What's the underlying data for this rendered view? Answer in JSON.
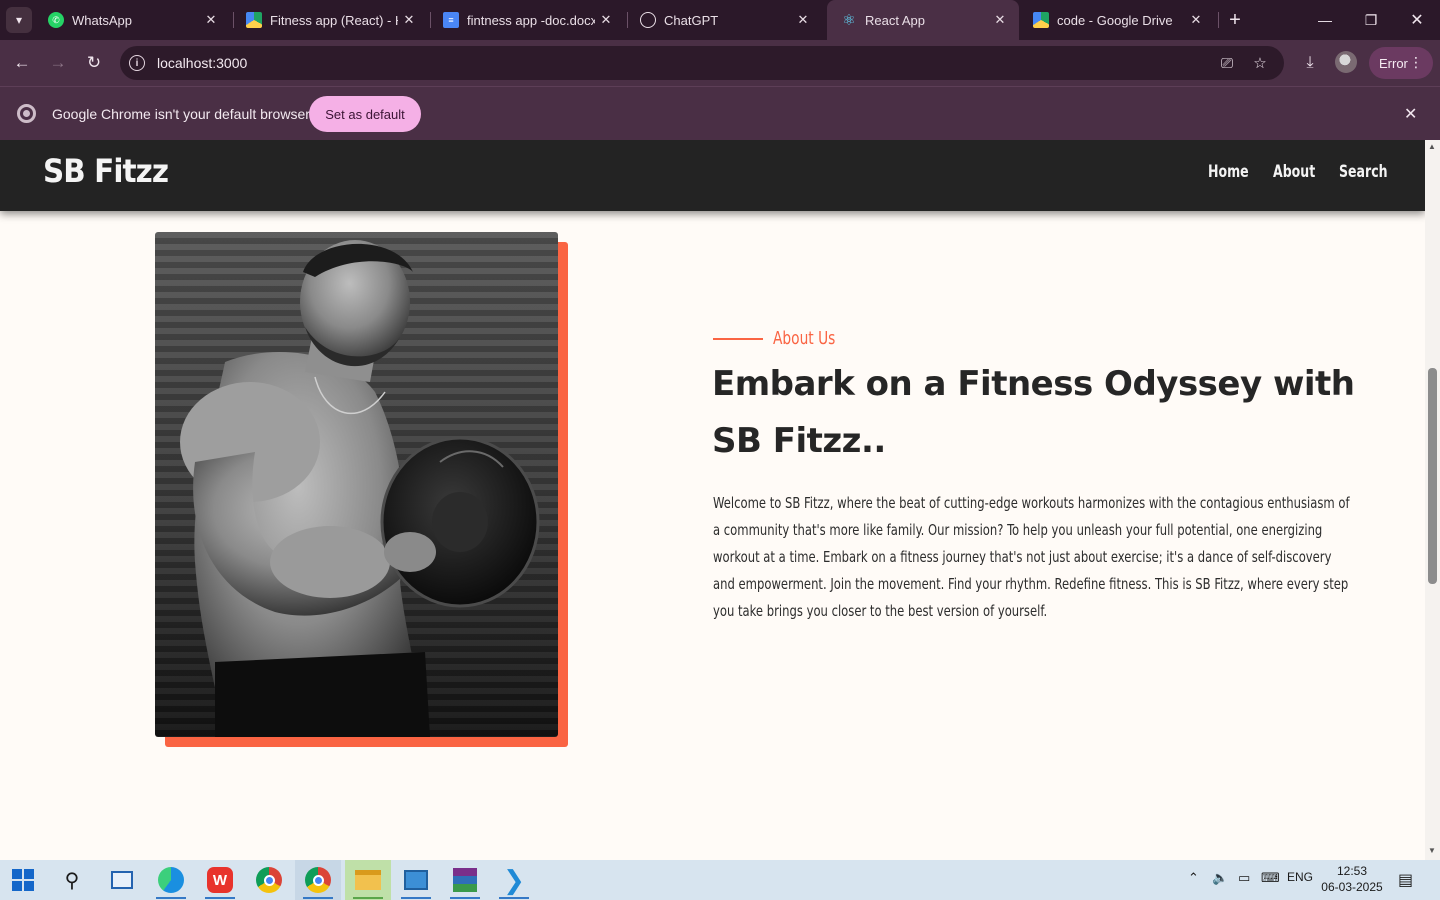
{
  "browser": {
    "tabs": [
      {
        "title": "WhatsApp",
        "icon": "whatsapp-icon",
        "active": false
      },
      {
        "title": "Fitness app (React) - Ha",
        "icon": "google-drive-icon",
        "active": false
      },
      {
        "title": "fintness app -doc.docx",
        "icon": "google-docs-icon",
        "active": false
      },
      {
        "title": "ChatGPT",
        "icon": "chatgpt-icon",
        "active": false
      },
      {
        "title": "React App",
        "icon": "react-icon",
        "active": true
      },
      {
        "title": "code - Google Drive",
        "icon": "google-drive-icon",
        "active": false
      }
    ],
    "url": "localhost:3000",
    "error_label": "Error",
    "infobar": {
      "message": "Google Chrome isn't your default browser",
      "button": "Set as default"
    }
  },
  "page": {
    "brand": "SB Fitzz",
    "nav": [
      "Home",
      "About",
      "Search"
    ],
    "about_label": "About Us",
    "headline": "Embark on a Fitness Odyssey with SB Fitzz..",
    "paragraph": "Welcome to SB Fitzz, where the beat of cutting-edge workouts harmonizes with the contagious enthusiasm of a community that's more like family. Our mission? To help you unleash your full potential, one energizing workout at a time. Embark on a fitness journey that's not just about exercise; it's a dance of self-discovery and empowerment. Join the movement. Find your rhythm. Redefine fitness. This is SB Fitzz, where every step you take brings you closer to the best version of yourself.",
    "accent_color": "#fa6443",
    "navbar_color": "#232323"
  },
  "taskbar": {
    "language": "ENG",
    "time": "12:53",
    "date": "06-03-2025"
  }
}
